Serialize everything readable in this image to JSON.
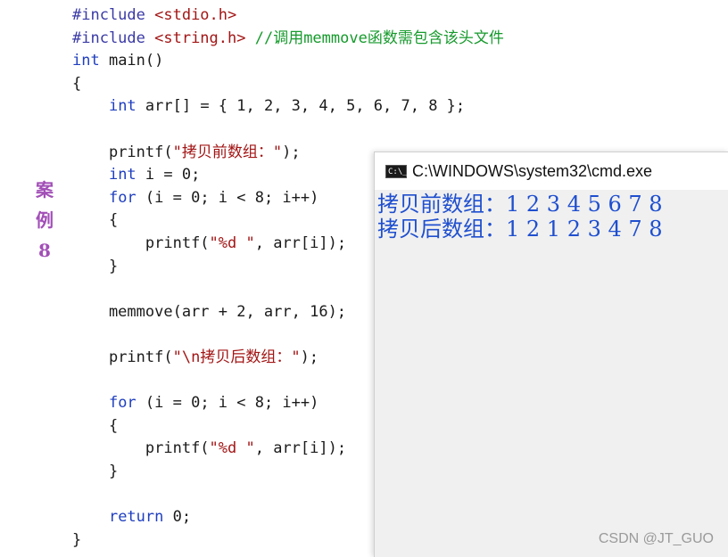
{
  "side_label": [
    "案",
    "例",
    "8"
  ],
  "code": {
    "l1": {
      "kw": "#include",
      "rest": " <stdio.h>"
    },
    "l2": {
      "kw": "#include",
      "rest": " <string.h>",
      "comment": " //调用memmove函数需包含该头文件"
    },
    "l3": {
      "kw": "int",
      "rest": " main()"
    },
    "l4": "{",
    "l5": {
      "indent": "    ",
      "kw": "int",
      "rest": " arr[] = { 1, 2, 3, 4, 5, 6, 7, 8 };"
    },
    "l7": {
      "indent": "    ",
      "fn": "printf(",
      "str": "\"拷贝前数组：\"",
      "end": ");"
    },
    "l8": {
      "indent": "    ",
      "kw": "int",
      "rest": " i = 0;"
    },
    "l9": {
      "indent": "    ",
      "kw": "for",
      "rest": " (i = 0; i < 8; i++)"
    },
    "l10": "    {",
    "l11": {
      "indent": "        ",
      "fn": "printf(",
      "str": "\"%d \"",
      "end": ", arr[i]);"
    },
    "l12": "    }",
    "l14": "    memmove(arr + 2, arr, 16);",
    "l16": {
      "indent": "    ",
      "fn": "printf(",
      "str": "\"\\n拷贝后数组：\"",
      "end": ");"
    },
    "l18": {
      "indent": "    ",
      "kw": "for",
      "rest": " (i = 0; i < 8; i++)"
    },
    "l19": "    {",
    "l20": {
      "indent": "        ",
      "fn": "printf(",
      "str": "\"%d \"",
      "end": ", arr[i]);"
    },
    "l21": "    }",
    "l23": {
      "indent": "    ",
      "kw": "return",
      "rest": " 0;"
    },
    "l24": "}"
  },
  "console": {
    "icon_text": "C:\\_",
    "title": "C:\\WINDOWS\\system32\\cmd.exe",
    "output": [
      "拷贝前数组：1 2 3 4 5 6 7 8",
      "拷贝后数组：1 2 1 2 3 4 7 8"
    ]
  },
  "watermark": "CSDN @JT_GUO",
  "colors": {
    "keyword": "#1f3fbf",
    "string": "#a31515",
    "comment": "#169a2c",
    "console_text": "#1f4fcf",
    "side_label": "#a24fb7"
  }
}
